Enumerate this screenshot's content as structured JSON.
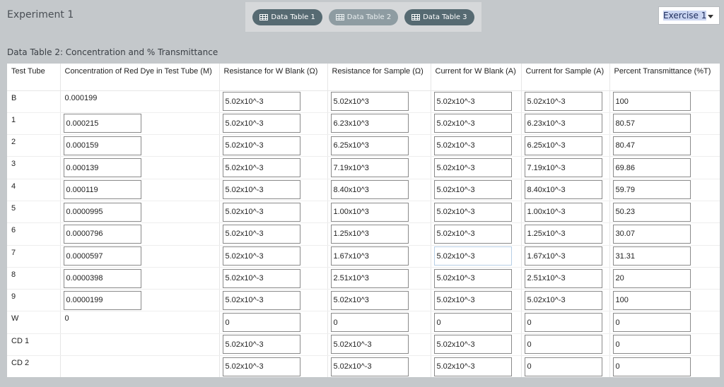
{
  "header": {
    "title": "Experiment 1",
    "tabs": [
      {
        "label": "Data Table 1",
        "icon": "table-icon"
      },
      {
        "label": "Data Table 2",
        "icon": "table-icon"
      },
      {
        "label": "Data Table 3",
        "icon": "table-icon"
      }
    ],
    "active_tab": "Data Table 2",
    "exercise_select": {
      "value": "Exercise 1"
    }
  },
  "table": {
    "title": "Data Table 2: Concentration and % Transmittance",
    "columns": [
      "Test Tube",
      "Concentration of Red Dye in Test Tube (M)",
      "Resistance for W Blank (Ω)",
      "Resistance for Sample (Ω)",
      "Current for W Blank (A)",
      "Current for Sample (A)",
      "Percent Transmittance (%T)"
    ],
    "rows": [
      {
        "tube": "B",
        "conc": "0.000199",
        "rw": "5.02x10^-3",
        "rs": "5.02x10^3",
        "cw": "5.02x10^-3",
        "cs": "5.02x10^-3",
        "pt": "100"
      },
      {
        "tube": "1",
        "conc": "0.000215",
        "rw": "5.02x10^-3",
        "rs": "6.23x10^3",
        "cw": "5.02x10^-3",
        "cs": "6.23x10^-3",
        "pt": "80.57"
      },
      {
        "tube": "2",
        "conc": "0.000159",
        "rw": "5.02x10^-3",
        "rs": "6.25x10^3",
        "cw": "5.02x10^-3",
        "cs": "6.25x10^-3",
        "pt": "80.47"
      },
      {
        "tube": "3",
        "conc": "0.000139",
        "rw": "5.02x10^-3",
        "rs": "7.19x10^3",
        "cw": "5.02x10^-3",
        "cs": "7.19x10^-3",
        "pt": "69.86"
      },
      {
        "tube": "4",
        "conc": "0.000119",
        "rw": "5.02x10^-3",
        "rs": "8.40x10^3",
        "cw": "5.02x10^-3",
        "cs": "8.40x10^-3",
        "pt": "59.79"
      },
      {
        "tube": "5",
        "conc": "0.0000995",
        "rw": "5.02x10^-3",
        "rs": "1.00x10^3",
        "cw": "5.02x10^-3",
        "cs": "1.00x10^-3",
        "pt": "50.23"
      },
      {
        "tube": "6",
        "conc": "0.0000796",
        "rw": "5.02x10^-3",
        "rs": "1.25x10^3",
        "cw": "5.02x10^-3",
        "cs": "1.25x10^-3",
        "pt": "30.07"
      },
      {
        "tube": "7",
        "conc": "0.0000597",
        "rw": "5.02x10^-3",
        "rs": "1.67x10^3",
        "cw": "5.02x10^-3",
        "cs": "1.67x10^-3",
        "pt": "31.31"
      },
      {
        "tube": "8",
        "conc": "0.0000398",
        "rw": "5.02x10^-3",
        "rs": "2.51x10^3",
        "cw": "5.02x10^-3",
        "cs": "2.51x10^-3",
        "pt": "20"
      },
      {
        "tube": "9",
        "conc": "0.0000199",
        "rw": "5.02x10^-3",
        "rs": "5.02x10^3",
        "cw": "5.02x10^-3",
        "cs": "5.02x10^-3",
        "pt": "100"
      },
      {
        "tube": "W",
        "conc": "0",
        "rw": "0",
        "rs": "0",
        "cw": "0",
        "cs": "0",
        "pt": "0"
      },
      {
        "tube": "CD 1",
        "conc": "",
        "rw": "5.02x10^-3",
        "rs": "5.02x10^-3",
        "cw": "5.02x10^-3",
        "cs": "0",
        "pt": "0"
      },
      {
        "tube": "CD 2",
        "conc": "",
        "rw": "5.02x10^-3",
        "rs": "5.02x10^-3",
        "cw": "5.02x10^-3",
        "cs": "0",
        "pt": "0"
      }
    ]
  }
}
